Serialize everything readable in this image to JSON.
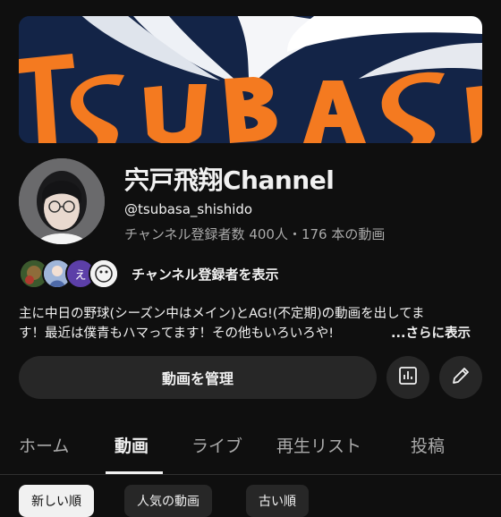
{
  "banner": {
    "text": "TSUBASA"
  },
  "channel": {
    "name": "宍戸飛翔Channel",
    "handle": "@tsubasa_shishido",
    "stats": "チャンネル登録者数 400人・176 本の動画"
  },
  "subscribers": {
    "avatar_letter": "え",
    "label": "チャンネル登録者を表示"
  },
  "description": {
    "line1": "主に中日の野球(シーズン中はメイン)とAG!(不定期)の動画を出してま",
    "line2": "す！最近は僕青もハマってます！その他もいろいろや!",
    "more": "...さらに表示"
  },
  "actions": {
    "manage_label": "動画を管理",
    "analytics_icon": "analytics-icon",
    "edit_icon": "edit-pencil-icon"
  },
  "tabs": [
    {
      "label": "ホーム"
    },
    {
      "label": "動画"
    },
    {
      "label": "ライブ"
    },
    {
      "label": "再生リスト"
    },
    {
      "label": "投稿"
    }
  ],
  "active_tab": "動画",
  "chips": [
    {
      "label": "新しい順"
    },
    {
      "label": "人気の動画"
    },
    {
      "label": "古い順"
    }
  ],
  "colors": {
    "background": "#0f0f0f",
    "surface": "#272727",
    "text": "#f1f1f1",
    "secondary_text": "#aaaaaa",
    "banner_navy": "#132447",
    "banner_orange": "#f47a20"
  }
}
